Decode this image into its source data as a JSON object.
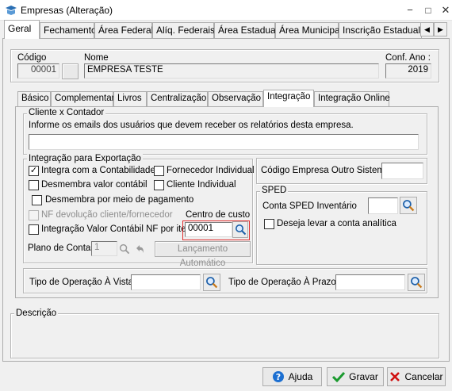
{
  "window": {
    "title": "Empresas (Alteração)",
    "minimize": "−",
    "maximize": "□",
    "close": "✕"
  },
  "tabs": [
    "Geral",
    "Fechamento",
    "Área Federal",
    "Alíq. Federais",
    "Área Estadual",
    "Área Municipal",
    "Inscrição Estadual S"
  ],
  "header": {
    "codigo_label": "Código",
    "codigo_value": "00001",
    "nome_label": "Nome",
    "nome_value": "EMPRESA TESTE",
    "conf_ano_label": "Conf. Ano :",
    "conf_ano_value": "2019"
  },
  "inner_tabs": [
    "Básico",
    "Complementar",
    "Livros",
    "Centralização",
    "Observação",
    "Integração",
    "Integração Online"
  ],
  "cliente_contador": {
    "legend": "Cliente x Contador",
    "instruction": "Informe os emails dos usuários que devem receber os relatórios desta empresa.",
    "email_value": ""
  },
  "integracao": {
    "legend": "Integração para Exportação",
    "integra_contabilidade": {
      "label": "Integra com a Contabilidade",
      "checked": "✓"
    },
    "fornecedor_individual": {
      "label": "Fornecedor Individual",
      "checked": ""
    },
    "desmembra_valor": {
      "label": "Desmembra valor contábil",
      "checked": ""
    },
    "cliente_individual": {
      "label": "Cliente Individual",
      "checked": ""
    },
    "desmembra_pagamento": {
      "label": "Desmembra por meio de pagamento",
      "checked": ""
    },
    "nf_devolucao": {
      "label": "NF devolução cliente/fornecedor",
      "checked": ""
    },
    "integracao_valor": {
      "label": "Integração Valor Contábil NF por item",
      "checked": ""
    },
    "centro_custo_label": "Centro de custo",
    "centro_custo_value": "00001",
    "plano_contas_label": "Plano de Contas",
    "plano_contas_value": "1",
    "lancamento_button": "Lançamento Automático"
  },
  "codigo_outro": {
    "label": "Código Empresa Outro Sistema",
    "value": ""
  },
  "sped": {
    "legend": "SPED",
    "conta_inventario_label": "Conta SPED Inventário",
    "conta_inventario_value": "",
    "conta_analitica": {
      "label": "Deseja levar a conta analítica",
      "checked": ""
    }
  },
  "operacao": {
    "avista_label": "Tipo de Operação À Vista:",
    "avista_value": "",
    "aprazo_label": "Tipo de Operação À Prazo:",
    "aprazo_value": ""
  },
  "descricao": {
    "legend": "Descrição"
  },
  "footer": {
    "ajuda": "Ajuda",
    "gravar": "Gravar",
    "cancelar": "Cancelar"
  },
  "colors": {
    "highlight_border": "#e03030",
    "accent_blue": "#1c6fd1",
    "check_green": "#1b9a2f",
    "cancel_red": "#d01010"
  }
}
